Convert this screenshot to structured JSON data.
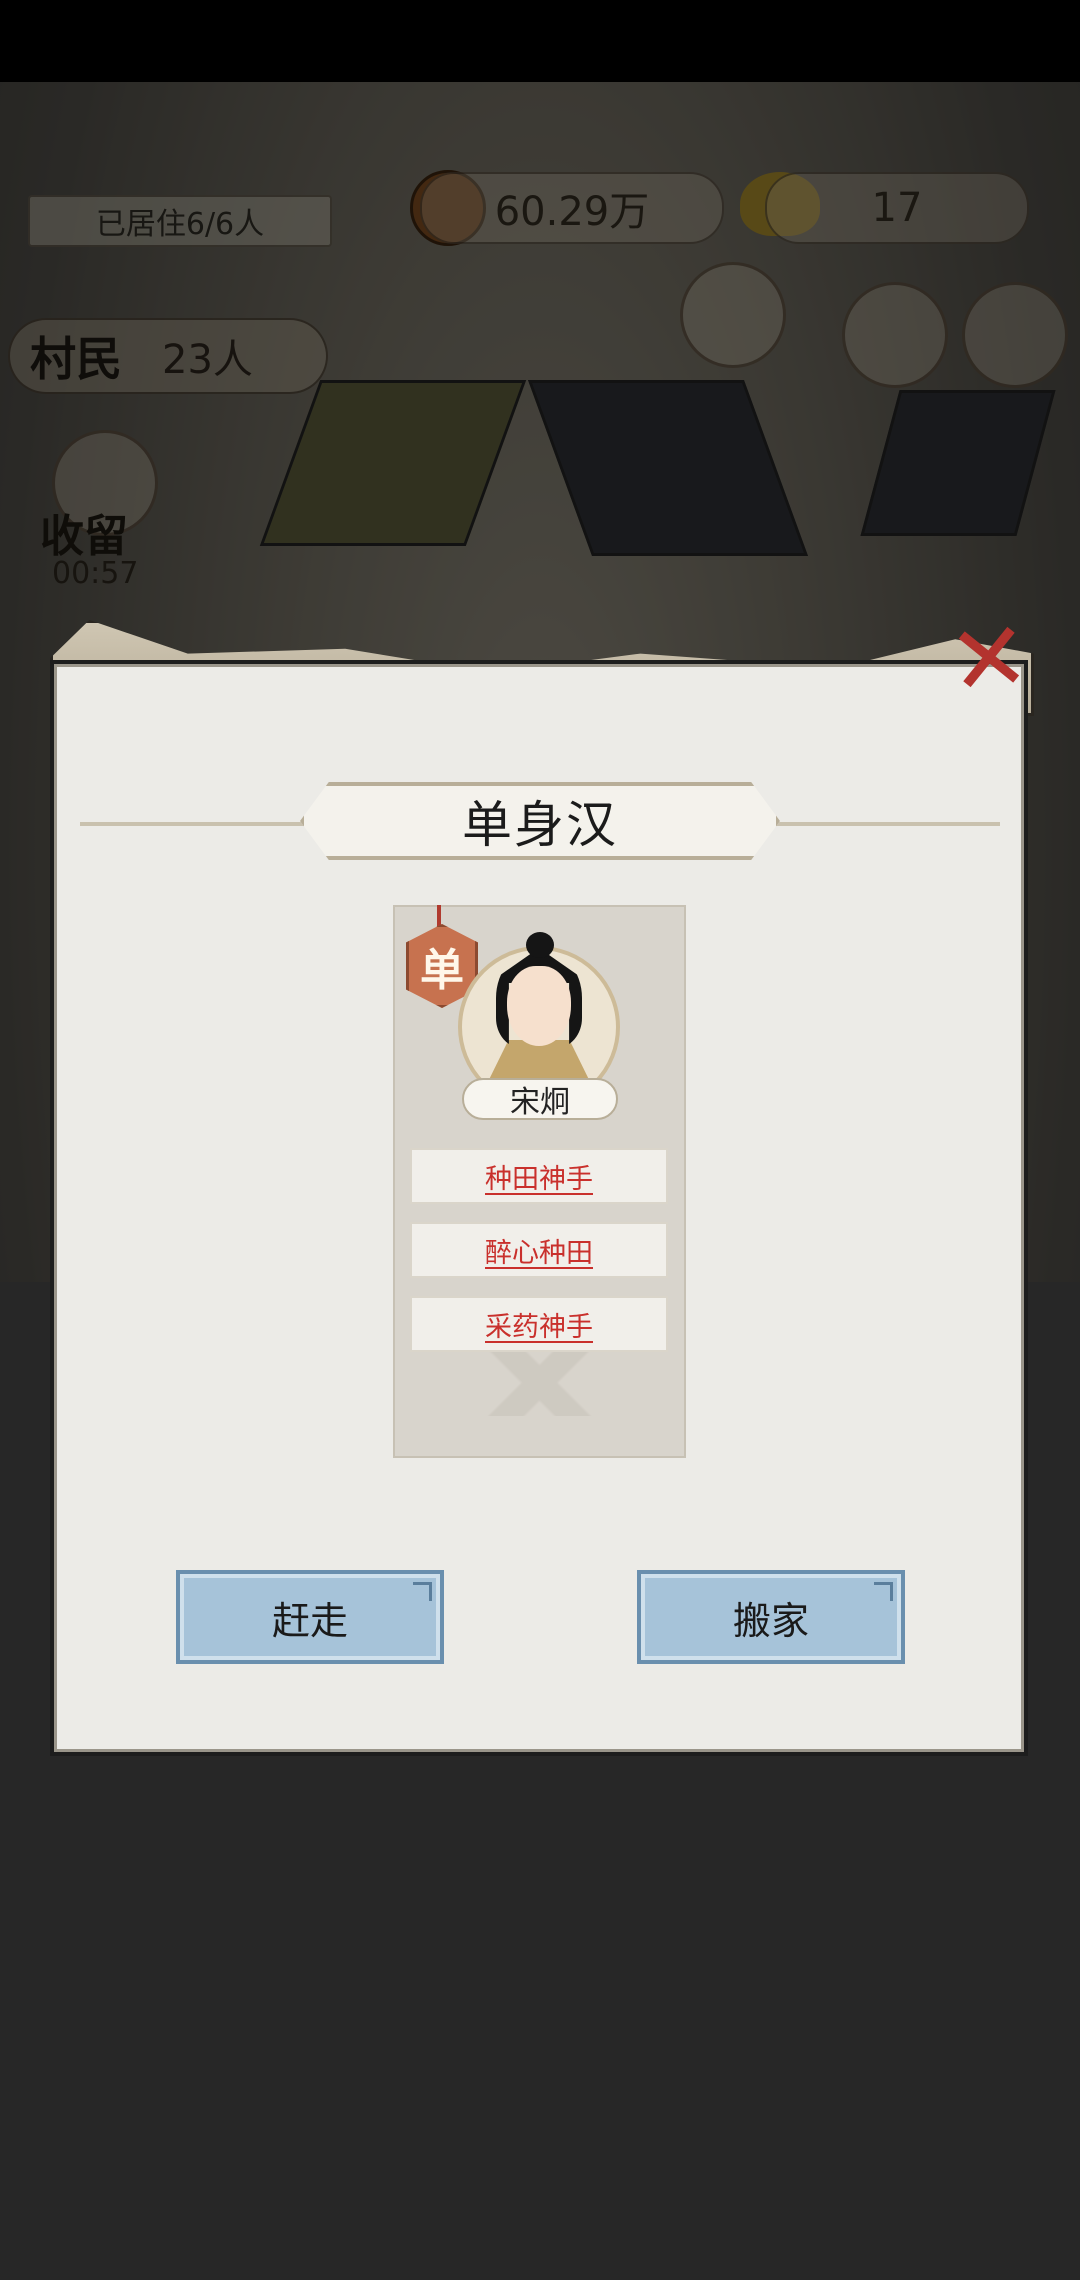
{
  "hud": {
    "resident_status": "已居住6/6人",
    "coins": "60.29万",
    "gems": "17",
    "villagers_label": "村民",
    "villagers_count": "23人",
    "keep_label": "收留",
    "keep_timer": "00:57"
  },
  "dialog": {
    "title": "单身汉",
    "tag": "单",
    "villager_name": "宋炯",
    "traits": [
      "种田神手",
      "醉心种田",
      "采药神手"
    ],
    "buttons": {
      "evict": "赶走",
      "move": "搬家"
    }
  },
  "colors": {
    "button_bg": "#a6c3d9",
    "trait_text": "#c9302c",
    "tag_bg": "#c7724f",
    "close": "#b3332e"
  }
}
